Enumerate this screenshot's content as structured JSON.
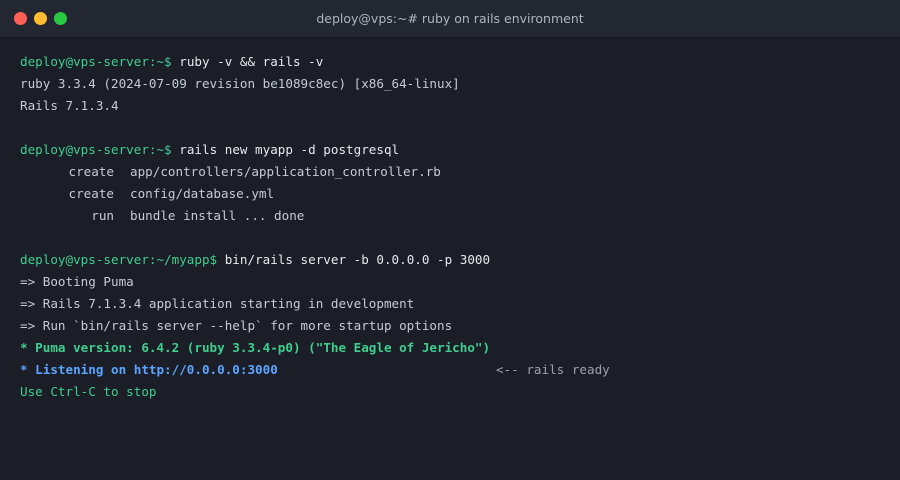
{
  "window": {
    "title": "deploy@vps:~# ruby on rails environment",
    "colors": {
      "close": "#ff5f57",
      "minimize": "#febc2e",
      "maximize": "#28c840",
      "background": "#1b1e27",
      "prompt": "#3ecf8e",
      "url": "#5aa5ff"
    }
  },
  "terminal": {
    "block1": {
      "prompt": "deploy@vps-server:~$",
      "command": " ruby -v && rails -v",
      "output": [
        "ruby 3.3.4 (2024-07-09 revision be1089c8ec) [x86_64-linux]",
        "Rails 7.1.3.4"
      ]
    },
    "block2": {
      "prompt": "deploy@vps-server:~$",
      "command": " rails new myapp -d postgresql",
      "generator": [
        {
          "action": "create",
          "path": "app/controllers/application_controller.rb"
        },
        {
          "action": "create",
          "path": "config/database.yml"
        },
        {
          "action": "run",
          "path": "bundle install ... done"
        }
      ]
    },
    "block3": {
      "prompt": "deploy@vps-server:~/myapp$",
      "command": " bin/rails server -b 0.0.0.0 -p 3000",
      "output": [
        "=> Booting Puma",
        "=> Rails 7.1.3.4 application starting in development",
        "=> Run `bin/rails server --help` for more startup options"
      ],
      "puma_version": "* Puma version: 6.4.2 (ruby 3.3.4-p0) (\"The Eagle of Jericho\")",
      "listening": "* Listening on http://0.0.0.0:3000",
      "annotation": "<-- rails ready",
      "stop_hint": "Use Ctrl-C to stop"
    }
  }
}
